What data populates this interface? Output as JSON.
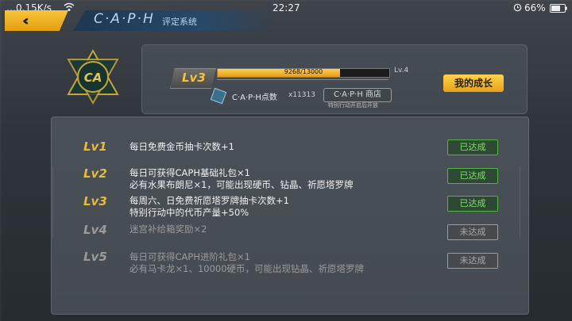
{
  "status_bar": {
    "left": "…0.15K/s",
    "time": "22:27",
    "battery": "66%"
  },
  "header": {
    "back_icon": "double-chevron-left-icon",
    "title": "C·A·P·H",
    "subtitle": "评定系统"
  },
  "profile": {
    "level": "Lv3",
    "exp_text": "9268/13000",
    "exp_fraction": 0.713,
    "next_level": "Lv.4",
    "growth_button": "我的成长",
    "points_label": "C·A·P·H点数",
    "points_count": "x11313",
    "shop_button": "C·A·P·H 商店",
    "shop_note": "特别行动开启后开放"
  },
  "levels": [
    {
      "level": "Lv1",
      "lines": [
        "每日免费金币抽卡次数+1"
      ],
      "status": "已达成",
      "achieved": true
    },
    {
      "level": "Lv2",
      "lines": [
        "每日可获得CAPH基础礼包×1",
        "必有水果布朗尼×1，可能出现硬币、钻晶、祈愿塔罗牌"
      ],
      "status": "已达成",
      "achieved": true
    },
    {
      "level": "Lv3",
      "lines": [
        "每周六、日免费祈愿塔罗牌抽卡次数+1",
        "特别行动中的代币产量+50%"
      ],
      "status": "已达成",
      "achieved": true
    },
    {
      "level": "Lv4",
      "lines": [
        "迷宫补给箱奖励×2"
      ],
      "status": "未达成",
      "achieved": false
    },
    {
      "level": "Lv5",
      "lines": [
        "每日可获得CAPH进阶礼包×1",
        "必有马卡龙×1、10000硬币，可能出现钻晶、祈愿塔罗牌"
      ],
      "status": "未达成",
      "achieved": false
    }
  ],
  "colors": {
    "accent": "#f0b52a",
    "achieved": "#7fe06a",
    "locked": "#9a9a9a"
  }
}
